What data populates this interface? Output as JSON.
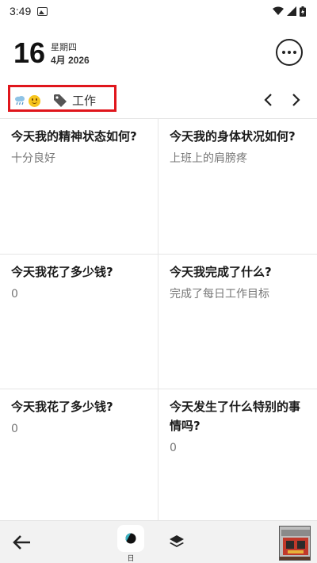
{
  "status_bar": {
    "time": "3:49"
  },
  "header": {
    "day": "16",
    "weekday": "星期四",
    "month_year": "4月 2026"
  },
  "tag_row": {
    "weather_icon": "cloud-rain-icon",
    "mood_icon": "smiley-face-icon",
    "tag_icon": "tag-icon",
    "tag_label": "工作",
    "highlight_color": "#e0161c"
  },
  "cards": [
    {
      "question": "今天我的精神状态如何?",
      "answer": "十分良好"
    },
    {
      "question": "今天我的身体状况如何?",
      "answer": "上班上的肩膀疼"
    },
    {
      "question": "今天我花了多少钱?",
      "answer": "0"
    },
    {
      "question": "今天我完成了什么?",
      "answer": "完成了每日工作目标"
    },
    {
      "question": "今天我花了多少钱?",
      "answer": "0"
    },
    {
      "question": "今天发生了什么特别的事情吗?",
      "answer": "0"
    }
  ],
  "bottom_bar": {
    "day_label": "日",
    "back_icon": "arrow-left-icon",
    "view_icon": "half-circle-icon",
    "layers_icon": "layers-icon"
  }
}
